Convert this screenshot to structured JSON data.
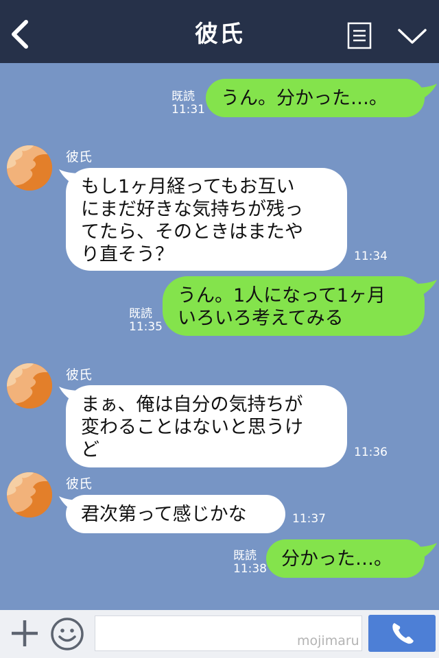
{
  "header": {
    "title": "彼氏",
    "back_icon": "chevron-left-icon",
    "menu_icon": "note-icon",
    "more_icon": "chevron-down-icon"
  },
  "messages": [
    {
      "direction": "out",
      "text": "うん。分かった…。",
      "read": "既読",
      "time": "11:31"
    },
    {
      "direction": "in",
      "sender": "彼氏",
      "text": "もし1ヶ月経ってもお互い\nにまだ好きな気持ちが残っ\nてたら、そのときはまたや\nり直そう？",
      "time": "11:34"
    },
    {
      "direction": "out",
      "text": "うん。1人になって1ヶ月\nいろいろ考えてみる",
      "read": "既読",
      "time": "11:35"
    },
    {
      "direction": "in",
      "sender": "彼氏",
      "text": "まぁ、俺は自分の気持ちが\n変わることはないと思うけ\nど",
      "time": "11:36"
    },
    {
      "direction": "in",
      "sender": "彼氏",
      "text": "君次第って感じかな",
      "time": "11:37"
    },
    {
      "direction": "out",
      "text": "分かった…。",
      "read": "既読",
      "time": "11:38"
    }
  ],
  "footer": {
    "plus_icon": "plus-icon",
    "emoji_icon": "smiley-icon",
    "input_value": "",
    "watermark": "mojimaru",
    "call_icon": "phone-icon"
  },
  "colors": {
    "background": "#7795c5",
    "header": "#263149",
    "outgoing_bubble": "#84e34c",
    "incoming_bubble": "#ffffff",
    "call_button": "#4d7fd6"
  }
}
